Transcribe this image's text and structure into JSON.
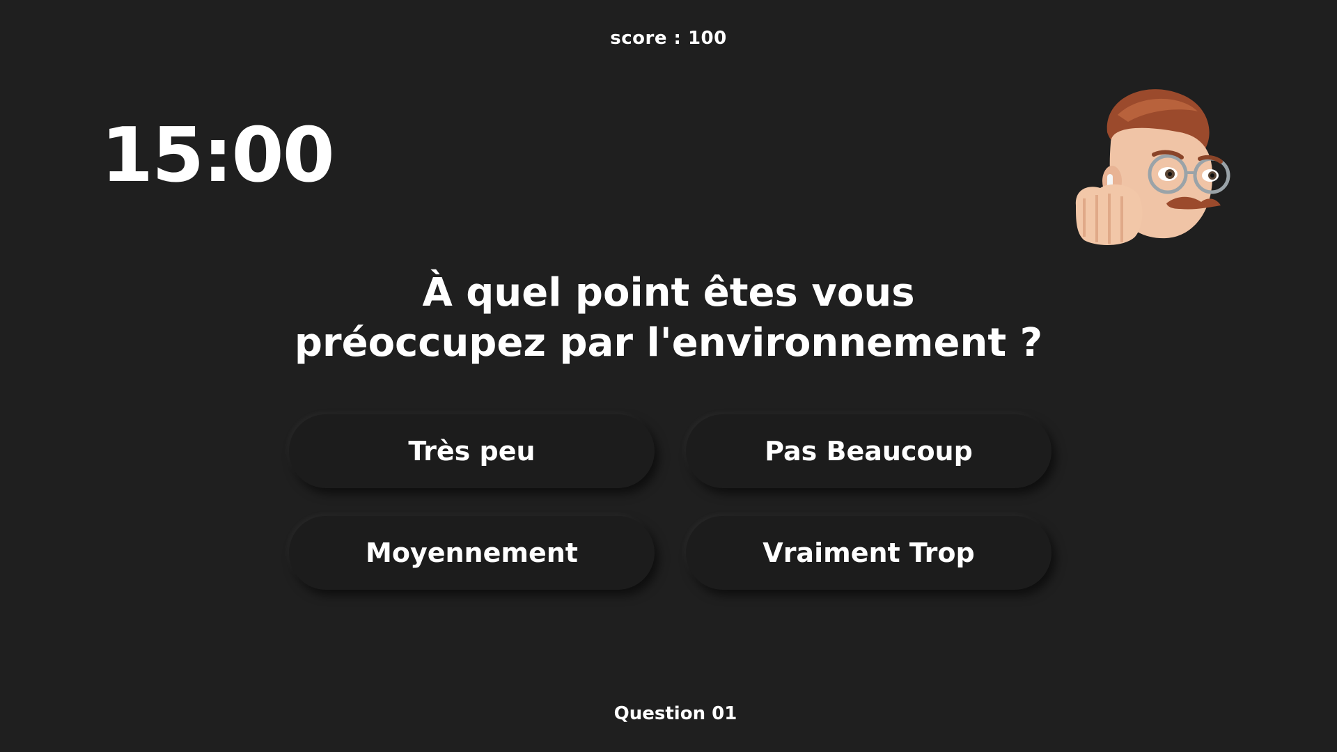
{
  "score": {
    "text": "score : 100"
  },
  "timer": {
    "text": "15:00"
  },
  "avatar": {
    "icon": "memoji-avatar-icon"
  },
  "question": {
    "line1": "À quel point êtes vous",
    "line2": "préoccupez par l'environnement ?"
  },
  "answers": [
    {
      "label": "Très peu"
    },
    {
      "label": "Pas Beaucoup"
    },
    {
      "label": "Moyennement"
    },
    {
      "label": "Vraiment Trop"
    }
  ],
  "footer": {
    "question_number": "Question 01"
  },
  "colors": {
    "background": "#1f1f1f",
    "button": "#1c1c1c",
    "text": "#ffffff"
  }
}
